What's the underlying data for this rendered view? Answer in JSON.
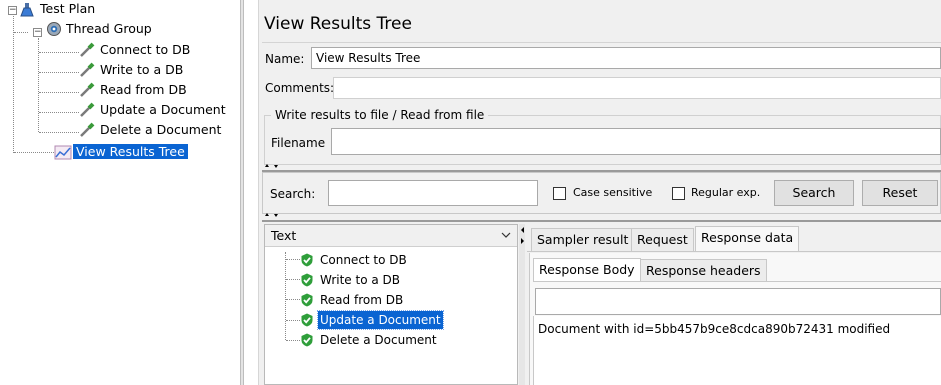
{
  "plan_tree": {
    "nodes": [
      {
        "label": "Test Plan",
        "icon": "flask-icon"
      },
      {
        "label": "Thread Group",
        "icon": "gear-icon"
      },
      {
        "label": "Connect to DB",
        "icon": "pipette-icon"
      },
      {
        "label": "Write to a DB",
        "icon": "pipette-icon"
      },
      {
        "label": "Read from DB",
        "icon": "pipette-icon"
      },
      {
        "label": "Update a Document",
        "icon": "pipette-icon"
      },
      {
        "label": "Delete a Document",
        "icon": "pipette-icon"
      },
      {
        "label": "View Results Tree",
        "icon": "graph-icon",
        "selected": true
      }
    ]
  },
  "listener": {
    "title": "View Results Tree",
    "name_label": "Name:",
    "name_value": "View Results Tree",
    "comments_label": "Comments:",
    "comments_value": "",
    "file_group_label": "Write results to file / Read from file",
    "filename_label": "Filename",
    "filename_value": ""
  },
  "search": {
    "label": "Search:",
    "value": "",
    "case_sensitive_label": "Case sensitive",
    "regular_exp_label": "Regular exp.",
    "search_button": "Search",
    "reset_button": "Reset"
  },
  "results": {
    "renderer": "Text",
    "samples": [
      {
        "label": "Connect to DB",
        "status": "success"
      },
      {
        "label": "Write to a DB",
        "status": "success"
      },
      {
        "label": "Read from DB",
        "status": "success"
      },
      {
        "label": "Update a Document",
        "status": "success",
        "selected": true
      },
      {
        "label": "Delete a Document",
        "status": "success"
      }
    ]
  },
  "detail": {
    "tabs": [
      "Sampler result",
      "Request",
      "Response data"
    ],
    "active_tab": "Response data",
    "sub_tabs": [
      "Response Body",
      "Response headers"
    ],
    "active_sub_tab": "Response Body",
    "response_body": "Document with id=5bb457b9ce8cdca890b72431 modified"
  },
  "colors": {
    "selection": "#0a64d2",
    "success": "#2f9e3a"
  }
}
